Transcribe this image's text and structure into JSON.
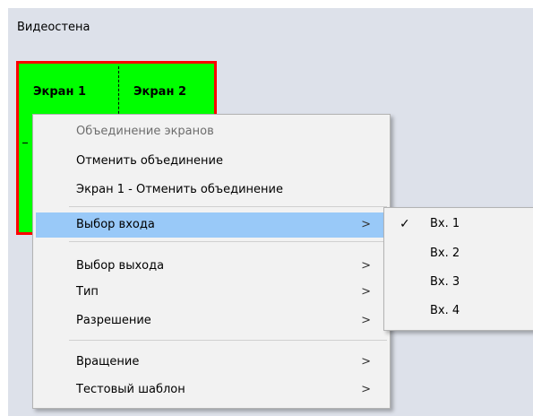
{
  "panel": {
    "title": "Видеостена"
  },
  "wall": {
    "screens": [
      "Экран 1",
      "Экран 2"
    ],
    "colors": {
      "fill": "#00ff00",
      "border": "#ff0000"
    }
  },
  "context_menu": {
    "items": [
      {
        "label": "Объединение экранов",
        "disabled": true
      },
      {
        "label": "Отменить объединение"
      },
      {
        "label": "Экран 1 - Отменить объединение"
      },
      {
        "label": "Выбор входа",
        "submenu": true,
        "highlighted": true
      },
      {
        "label": "Выбор выхода",
        "submenu": true
      },
      {
        "label": "Тип",
        "submenu": true
      },
      {
        "label": "Разрешение",
        "submenu": true
      },
      {
        "label": "Вращение",
        "submenu": true
      },
      {
        "label": "Тестовый шаблон",
        "submenu": true
      }
    ],
    "arrow": ">",
    "highlight_color": "#99c9f8"
  },
  "submenu": {
    "check_mark": "✓",
    "items": [
      {
        "label": "Вх. 1",
        "checked": true
      },
      {
        "label": "Вх. 2"
      },
      {
        "label": "Вх. 3"
      },
      {
        "label": "Вх. 4"
      }
    ]
  }
}
